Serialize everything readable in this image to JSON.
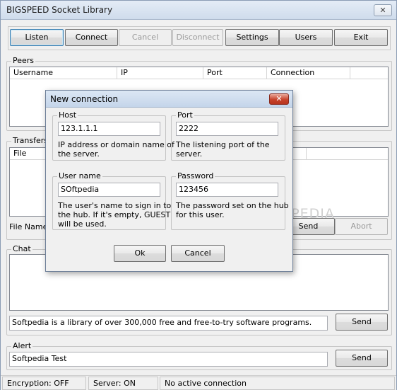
{
  "window": {
    "title": "BIGSPEED Socket Library",
    "close_glyph": "✕"
  },
  "toolbar": {
    "listen": "Listen",
    "connect": "Connect",
    "cancel": "Cancel",
    "disconnect": "Disconnect",
    "settings": "Settings",
    "users": "Users",
    "exit": "Exit"
  },
  "peers": {
    "label": "Peers",
    "columns": [
      "Username",
      "IP",
      "Port",
      "Connection"
    ]
  },
  "transfers": {
    "label": "Transfers",
    "columns": [
      "File"
    ],
    "file_name_label": "File Name:",
    "send": "Send",
    "abort": "Abort"
  },
  "chat": {
    "label": "Chat",
    "message_value": "Softpedia is a library of over 300,000 free and free-to-try software programs.",
    "send": "Send"
  },
  "alert": {
    "label": "Alert",
    "value": "Softpedia Test",
    "send": "Send"
  },
  "status": {
    "encryption": "Encryption: OFF",
    "server": "Server: ON",
    "connection": "No active connection"
  },
  "watermark": "SOFTPEDIA",
  "dialog": {
    "title": "New connection",
    "close_glyph": "✕",
    "host": {
      "label": "Host",
      "value": "123.1.1.1",
      "hint_line1": "IP address or domain name of",
      "hint_line2": "the server."
    },
    "port": {
      "label": "Port",
      "value": "2222",
      "hint_line1": "The listening port of the",
      "hint_line2": "server."
    },
    "username": {
      "label": "User name",
      "value": "SOftpedia",
      "hint_line1": "The user's name to sign in to",
      "hint_line2": "the hub. If it's empty, GUEST",
      "hint_line3": "will be used."
    },
    "password": {
      "label": "Password",
      "value": "123456",
      "hint_line1": "The password set on the hub",
      "hint_line2": "for this user."
    },
    "ok": "Ok",
    "cancel": "Cancel"
  }
}
